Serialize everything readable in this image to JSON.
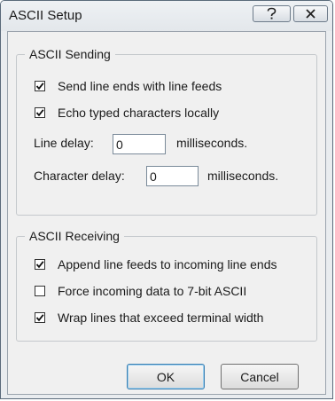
{
  "window": {
    "title": "ASCII Setup",
    "help_icon": "question-mark-icon",
    "close_icon": "close-x-icon"
  },
  "sending": {
    "group_title": "ASCII Sending",
    "send_line_ends": {
      "label": "Send line ends with line feeds",
      "checked": true
    },
    "echo_typed": {
      "label": "Echo typed characters locally",
      "checked": true
    },
    "line_delay": {
      "label": "Line delay:",
      "value": "0",
      "unit": "milliseconds."
    },
    "char_delay": {
      "label": "Character delay:",
      "value": "0",
      "unit": "milliseconds."
    }
  },
  "receiving": {
    "group_title": "ASCII Receiving",
    "append_line_feeds": {
      "label": "Append line feeds to incoming line ends",
      "checked": true
    },
    "force_7bit": {
      "label": "Force incoming data to 7-bit ASCII",
      "checked": false
    },
    "wrap_lines": {
      "label": "Wrap lines that exceed terminal width",
      "checked": true
    }
  },
  "buttons": {
    "ok": "OK",
    "cancel": "Cancel"
  }
}
